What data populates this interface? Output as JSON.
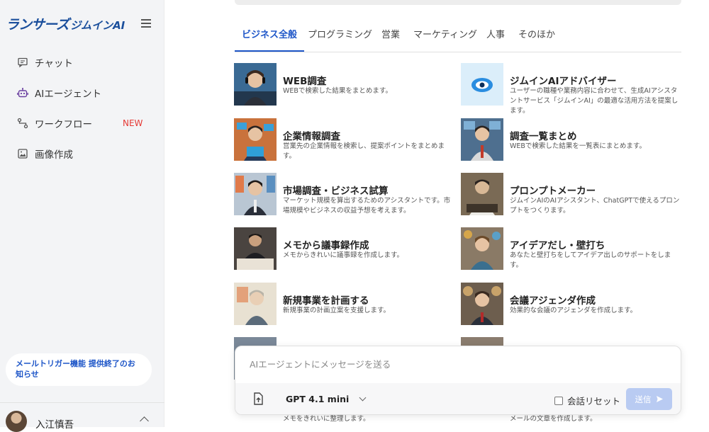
{
  "sidebar": {
    "logo_main": "ランサーズ",
    "logo_sub": "ジムインAI",
    "nav": [
      {
        "label": "チャット",
        "icon": "chat-icon"
      },
      {
        "label": "AIエージェント",
        "icon": "robot-icon"
      },
      {
        "label": "ワークフロー",
        "icon": "workflow-icon",
        "badge": "NEW"
      },
      {
        "label": "画像作成",
        "icon": "image-icon"
      }
    ],
    "notice": "メールトリガー機能 提供終了のお知らせ",
    "user_name": "入江慎吾"
  },
  "tabs": [
    "ビジネス全般",
    "プログラミング",
    "営業",
    "マーケティング",
    "人事",
    "そのほか"
  ],
  "active_tab": 0,
  "cards": [
    {
      "title": "WEB調査",
      "desc": "WEBで検索した結果をまとめます。"
    },
    {
      "title": "ジムインAIアドバイザー",
      "desc": "ユーザーの職種や業務内容に合わせて、生成AIアシスタントサービス「ジムインAI」の最適な活用方法を提案します。"
    },
    {
      "title": "企業情報調査",
      "desc": "営業先の企業情報を検索し、提案ポイントをまとめます。"
    },
    {
      "title": "調査一覧まとめ",
      "desc": "WEBで検索した結果を一覧表にまとめます。"
    },
    {
      "title": "市場調査・ビジネス試算",
      "desc": "マーケット規模を算出するためのアシスタントです。市場規模やビジネスの収益予想を考えます。"
    },
    {
      "title": "プロンプトメーカー",
      "desc": "ジムインAIのAIアシスタント、ChatGPTで使えるプロンプトをつくります。"
    },
    {
      "title": "メモから議事録作成",
      "desc": "メモからきれいに議事録を作成します。"
    },
    {
      "title": "アイデアだし・壁打ち",
      "desc": "あなたと壁打ちをしてアイデア出しのサポートをします。"
    },
    {
      "title": "新規事業を計画する",
      "desc": "新規事業の計画立案を支援します。"
    },
    {
      "title": "会議アジェンダ作成",
      "desc": "効果的な会議のアジェンダを作成します。"
    }
  ],
  "partial_texts": {
    "left": "メモをきれいに整理します。",
    "right": "メールの文章を作成します。"
  },
  "chat": {
    "placeholder": "AIエージェントにメッセージを送る",
    "model": "GPT 4.1 mini",
    "reset_label": "会話リセット",
    "send_label": "送信"
  },
  "colors": {
    "accent": "#1e56c8",
    "badge": "#e53935",
    "send_disabled": "#b9cbf2"
  }
}
